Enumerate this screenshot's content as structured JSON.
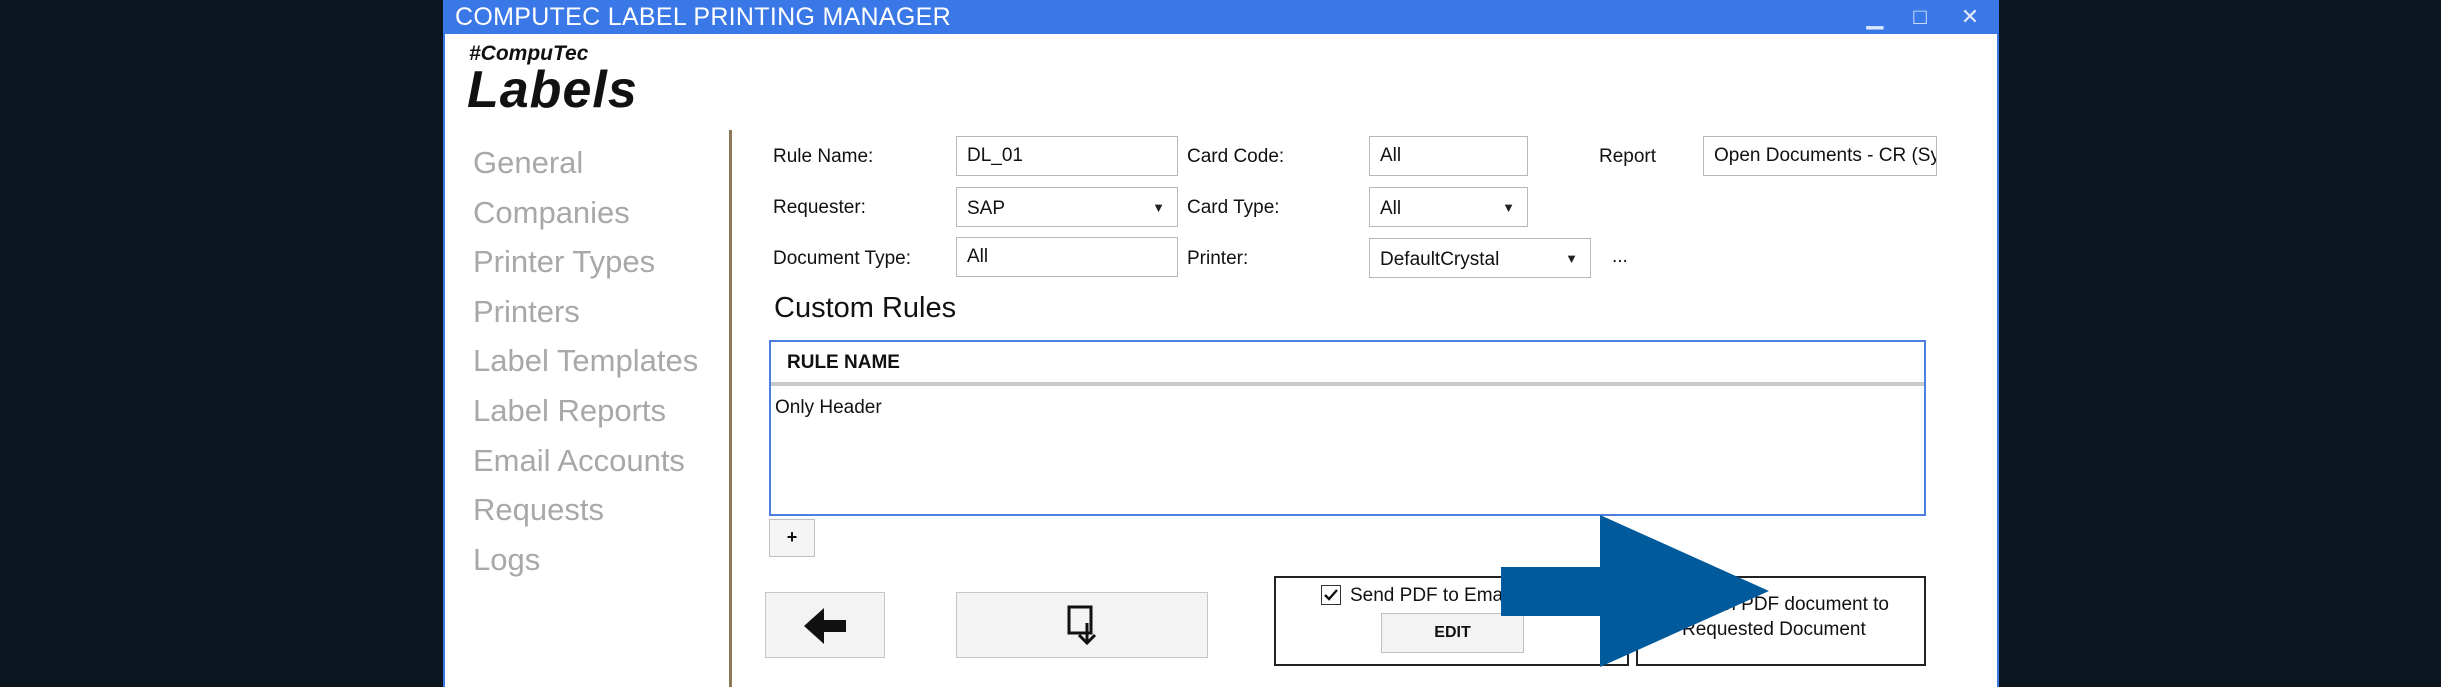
{
  "window": {
    "title": "COMPUTEC LABEL PRINTING MANAGER",
    "minimize": "▁",
    "maximize": "□",
    "close": "✕"
  },
  "brand": {
    "tagline": "#CompuTec",
    "name": "Labels"
  },
  "sidebar": {
    "items": [
      {
        "label": "General"
      },
      {
        "label": "Companies"
      },
      {
        "label": "Printer Types"
      },
      {
        "label": "Printers"
      },
      {
        "label": "Label Templates"
      },
      {
        "label": "Label Reports"
      },
      {
        "label": "Email Accounts"
      },
      {
        "label": "Requests"
      },
      {
        "label": "Logs"
      }
    ]
  },
  "form": {
    "rule_name_label": "Rule Name:",
    "rule_name": "DL_01",
    "card_code_label": "Card Code:",
    "card_code": "All",
    "report_label": "Report",
    "report": "Open Documents - CR (Sys",
    "requester_label": "Requester:",
    "requester": "SAP",
    "card_type_label": "Card Type:",
    "card_type": "All",
    "document_type_label": "Document Type:",
    "document_type": "All",
    "printer_label": "Printer:",
    "printer": "DefaultCrystal",
    "ellipsis": "..."
  },
  "custom_rules": {
    "title": "Custom Rules",
    "column": "RULE NAME",
    "rows": [
      "Only Header"
    ],
    "add_label": "+"
  },
  "options": {
    "send_pdf": {
      "label": "Send PDF to Email Recipient",
      "checked": true,
      "edit_label": "EDIT"
    },
    "attach_pdf": {
      "label_line1": "Attach PDF document to",
      "label_line2": "Requested Document",
      "checked": true
    }
  },
  "colors": {
    "titlebar": "#3b78e7",
    "arrow": "#005a9c",
    "sidebar_text": "#a8a8a8",
    "grid_border": "#4a7fe0"
  }
}
